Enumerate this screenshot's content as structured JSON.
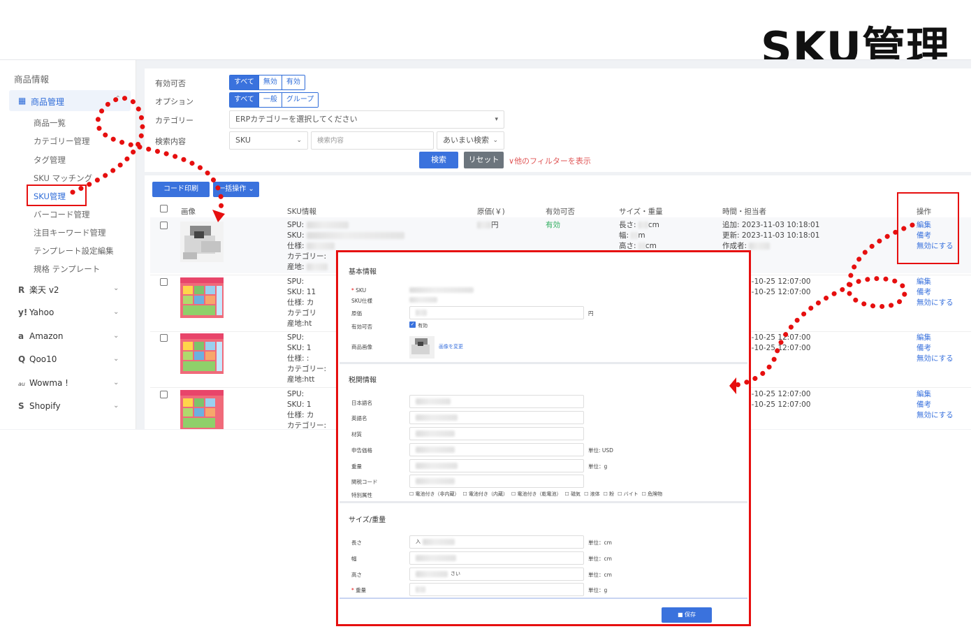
{
  "page_title": "SKU管理",
  "sidebar": {
    "section": "商品情報",
    "group": {
      "label": "商品管理",
      "icon": "shop-icon"
    },
    "subitems": [
      "商品一覧",
      "カテゴリー管理",
      "タグ管理",
      "SKU マッチング",
      "SKU管理",
      "バーコード管理",
      "注目キーワード管理",
      "テンプレート設定編集",
      "規格 テンプレート"
    ],
    "active_subitem": "SKU管理",
    "channels": [
      {
        "label": "楽天 v2",
        "icon": "R"
      },
      {
        "label": "Yahoo",
        "icon": "y!"
      },
      {
        "label": "Amazon",
        "icon": "a"
      },
      {
        "label": "Qoo10",
        "icon": "Q"
      },
      {
        "label": "Wowma !",
        "icon": "au"
      },
      {
        "label": "Shopify",
        "icon": "S"
      }
    ]
  },
  "filters": {
    "enabled_label": "有効可否",
    "enabled_options": [
      "すべて",
      "無効",
      "有効"
    ],
    "option_label": "オプション",
    "option_options": [
      "すべて",
      "一般",
      "グループ"
    ],
    "category_label": "カテゴリー",
    "category_placeholder": "ERPカテゴリーを選択してください",
    "search_label": "検索内容",
    "search_type": "SKU",
    "search_placeholder": "検索内容",
    "search_mode": "あいまい検索",
    "search_button": "検索",
    "reset_button": "リセット",
    "more_filters": "他のフィルターを表示"
  },
  "toolbar": {
    "print_button": "コード印刷",
    "bulk_button": "一括操作"
  },
  "table": {
    "headers": [
      "画像",
      "SKU情報",
      "原価(￥)",
      "有効可否",
      "サイズ・重量",
      "時間・担当者",
      "操作"
    ],
    "actions": [
      "編集",
      "備考",
      "無効にする"
    ],
    "rows": [
      {
        "sku_lines": [
          "SPU:",
          "SKU:",
          "仕様:",
          "カテゴリー:",
          "産地:"
        ],
        "price": "円",
        "status": "有効",
        "size_lines": [
          "長さ:",
          "幅:",
          "高さ:"
        ],
        "size_units": [
          "cm",
          "m",
          "cm"
        ],
        "time_lines": [
          "追加: 2023-11-03 10:18:01",
          "更新: 2023-11-03 10:18:01",
          "作成者:"
        ]
      },
      {
        "sku_lines": [
          "SPU:",
          "SKU: 11",
          "仕様: カ",
          "カテゴリ",
          "産地:ht"
        ],
        "time_lines": [
          "3-10-25 12:07:00",
          "3-10-25 12:07:00"
        ]
      },
      {
        "sku_lines": [
          "SPU:",
          "SKU: 1",
          "仕様: :",
          "カテゴリー:",
          "産地:htt"
        ],
        "time_lines": [
          "3-10-25 12:07:00",
          "3-10-25 12:07:00"
        ]
      },
      {
        "sku_lines": [
          "SPU:",
          "SKU: 1",
          "仕様: カ",
          "カテゴリー:"
        ],
        "time_lines": [
          "3-10-25 12:07:00",
          "3-10-25 12:07:00"
        ]
      }
    ]
  },
  "modal": {
    "basic_section": "基本情報",
    "sku_label": "SKU",
    "sku_spec_label": "SKU仕様",
    "price_label": "原価",
    "price_unit": "円",
    "enabled_label": "有効可否",
    "enabled_value": "有効",
    "image_label": "商品画像",
    "change_image": "画像を変更",
    "customs_section": "税関情報",
    "jp_name_label": "日本語名",
    "en_name_label": "英語名",
    "material_label": "材質",
    "declared_price_label": "申告価格",
    "declared_price_unit": "単位: USD",
    "weight_label": "重量",
    "weight_unit": "単位：g",
    "hs_code_label": "関税コード",
    "special_label": "特別属性",
    "special_options": [
      "電池付き（非内蔵）",
      "電池付き（内蔵）",
      "電池付き（乾電池）",
      "磁気",
      "液体",
      "粉",
      "バイト",
      "危険物"
    ],
    "size_section": "サイズ/重量",
    "length_label": "長さ",
    "length_prefix": "入",
    "width_label": "幅",
    "height_label": "高さ",
    "height_suffix": "さい",
    "weight2_label": "重量",
    "cm_unit": "単位：cm",
    "g_unit": "単位：g",
    "save_button": "保存"
  },
  "colors": {
    "primary": "#3a72dd",
    "highlight_red": "#e60f0f",
    "status_green": "#2fae5f",
    "link_red": "#e05555"
  }
}
